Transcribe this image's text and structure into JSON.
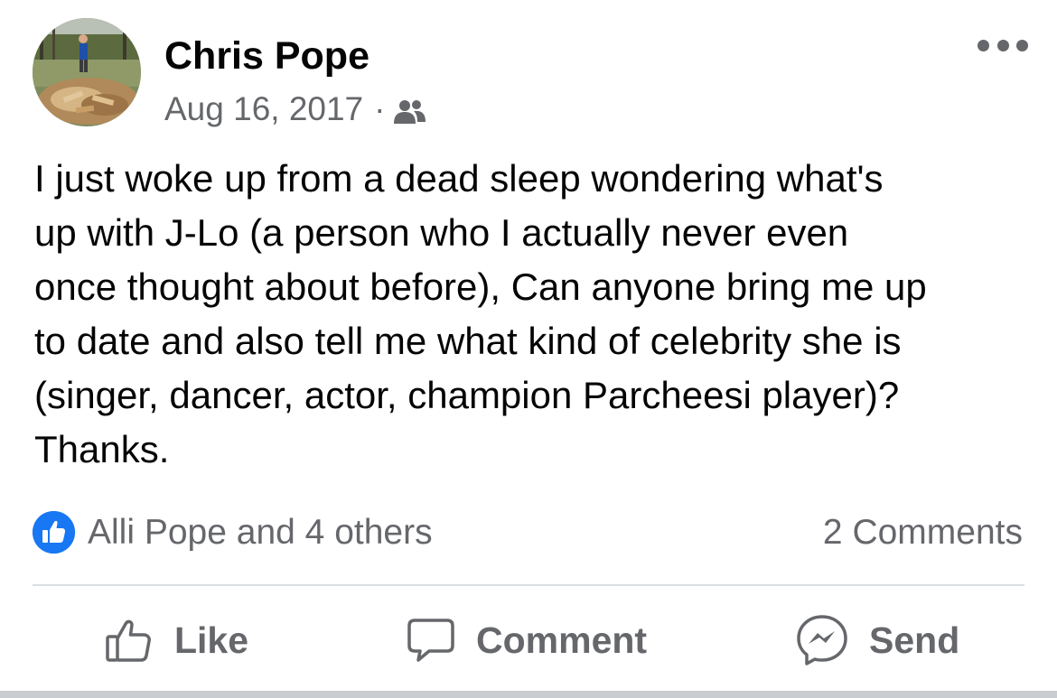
{
  "post": {
    "author": "Chris Pope",
    "date": "Aug 16, 2017",
    "separator": "·",
    "audience_icon": "friends-icon",
    "more_icon": "more-options-icon",
    "text_lines": [
      "I just woke up from a dead sleep wondering what's",
      "up with J-Lo (a person who I actually never even",
      "once thought about before), Can anyone bring me up",
      "to date and also tell me what kind of celebrity she is",
      "(singer, dancer, actor, champion Parcheesi player)?",
      "Thanks."
    ]
  },
  "reactions": {
    "icon": "like-reaction-icon",
    "summary": "Alli Pope and 4 others",
    "comments": "2 Comments"
  },
  "actions": {
    "like": {
      "label": "Like",
      "icon": "thumbs-up-icon"
    },
    "comment": {
      "label": "Comment",
      "icon": "speech-bubble-icon"
    },
    "send": {
      "label": "Send",
      "icon": "messenger-icon"
    }
  },
  "colors": {
    "text": "#050505",
    "secondary_text": "#65676b",
    "accent": "#1877f2",
    "divider": "#dadde1"
  }
}
